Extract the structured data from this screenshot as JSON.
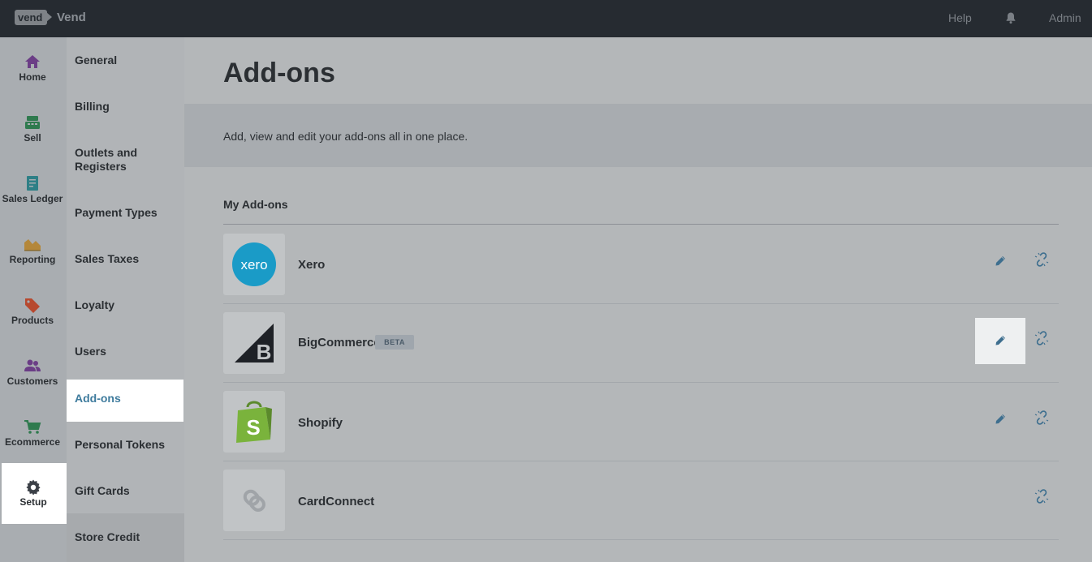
{
  "topbar": {
    "logo_text": "vend",
    "brand": "Vend",
    "help": "Help",
    "bell_icon": "bell-icon",
    "user": "Admin"
  },
  "rail": {
    "items": [
      {
        "label": "Home",
        "icon": "home-icon",
        "color": "#6b3d86"
      },
      {
        "label": "Sell",
        "icon": "register-icon",
        "color": "#2f7a4e"
      },
      {
        "label": "Sales Ledger",
        "icon": "receipt-icon",
        "color": "#2e7f86"
      },
      {
        "label": "Reporting",
        "icon": "area-chart-icon",
        "color": "#b4873a"
      },
      {
        "label": "Products",
        "icon": "tag-icon",
        "color": "#b7492f"
      },
      {
        "label": "Customers",
        "icon": "users-icon",
        "color": "#6b3d86"
      },
      {
        "label": "Ecommerce",
        "icon": "cart-icon",
        "color": "#2f7a4e"
      },
      {
        "label": "Setup",
        "icon": "gear-icon",
        "color": "#3b4047"
      }
    ]
  },
  "subnav": {
    "items": [
      {
        "label": "General"
      },
      {
        "label": "Billing"
      },
      {
        "label": "Outlets and Registers"
      },
      {
        "label": "Payment Types"
      },
      {
        "label": "Sales Taxes"
      },
      {
        "label": "Loyalty"
      },
      {
        "label": "Users"
      },
      {
        "label": "Add-ons"
      },
      {
        "label": "Personal Tokens"
      },
      {
        "label": "Gift Cards"
      },
      {
        "label": "Store Credit"
      }
    ],
    "active": "Add-ons"
  },
  "main": {
    "title": "Add-ons",
    "description": "Add, view and edit your add-ons all in one place.",
    "section_title": "My Add-ons",
    "addons": [
      {
        "name": "Xero",
        "logo": "xero-logo",
        "logo_text": "xero",
        "editable": true,
        "beta": false
      },
      {
        "name": "BigCommerce",
        "logo": "bigcommerce-logo",
        "logo_text": "B",
        "editable": true,
        "beta": true,
        "badge": "BETA"
      },
      {
        "name": "Shopify",
        "logo": "shopify-logo",
        "logo_text": "S",
        "editable": true,
        "beta": false
      },
      {
        "name": "CardConnect",
        "logo": "link-placeholder-logo",
        "editable": false,
        "beta": false
      }
    ]
  },
  "colors": {
    "topbar_bg": "#262b31",
    "active_link": "#3e7b9d",
    "xero_blue": "#1a9bc7",
    "shopify_green": "#7ab33c"
  }
}
